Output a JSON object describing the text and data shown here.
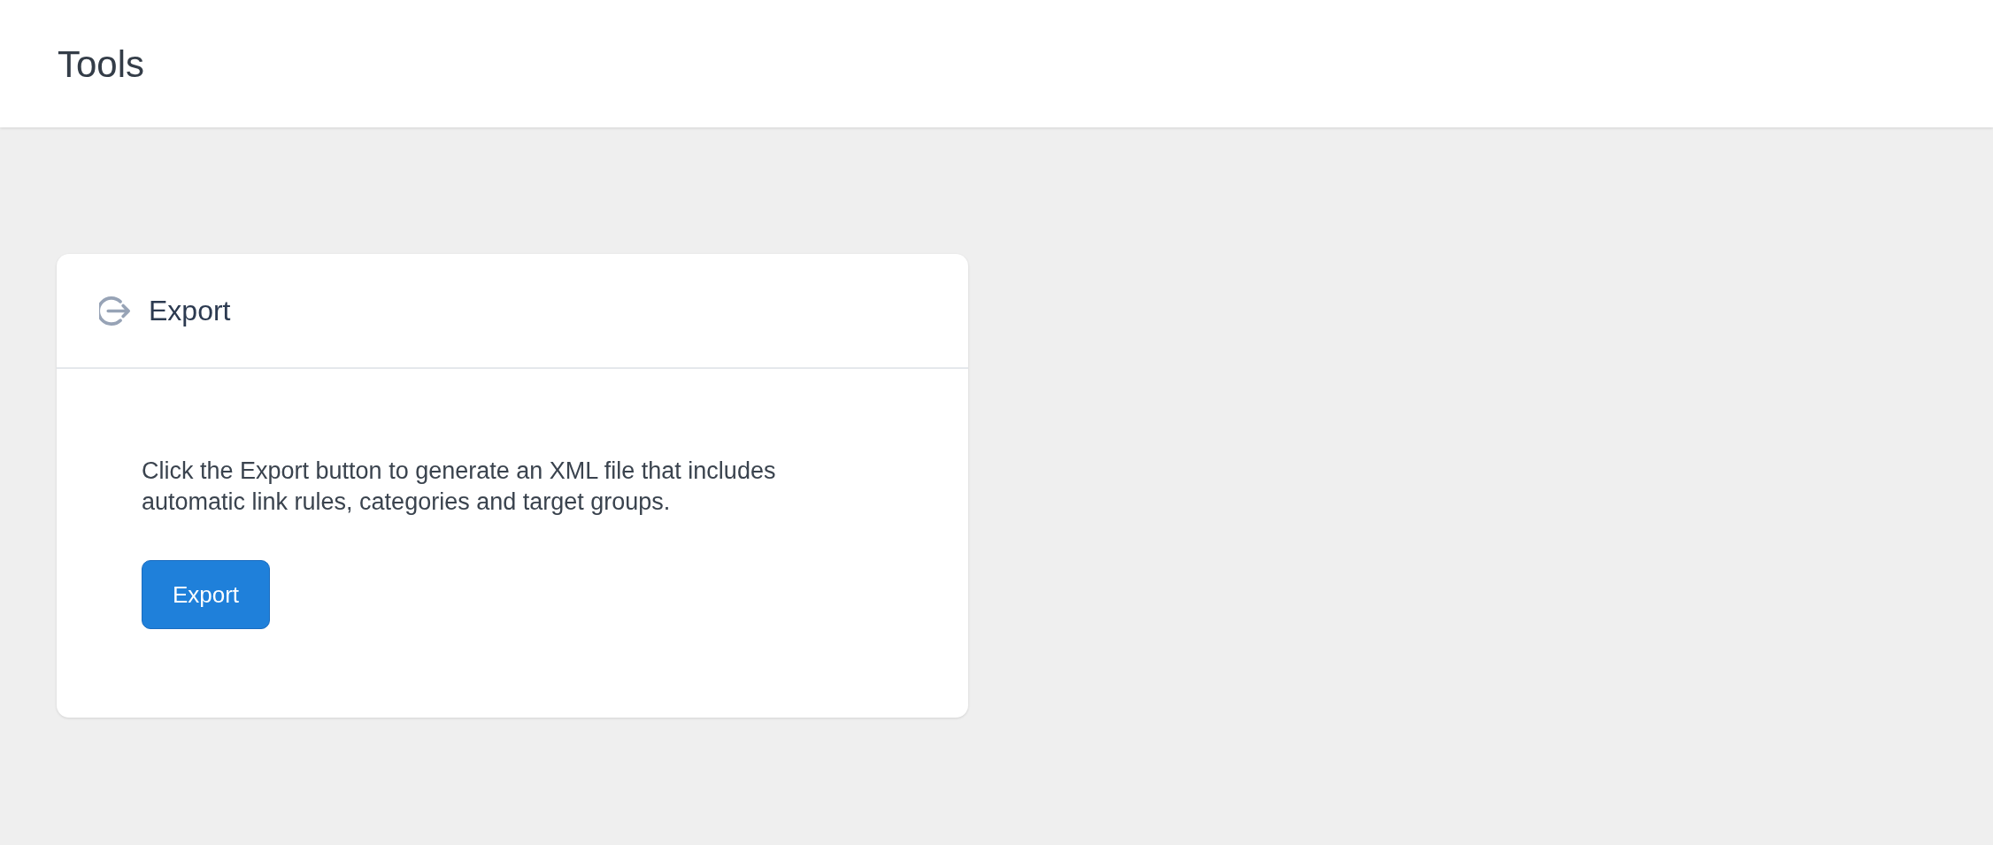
{
  "header": {
    "title": "Tools"
  },
  "card": {
    "title": "Export",
    "description": "Click the Export button to generate an XML file that includes automatic link rules, categories and target groups.",
    "button": {
      "label": "Export"
    }
  }
}
